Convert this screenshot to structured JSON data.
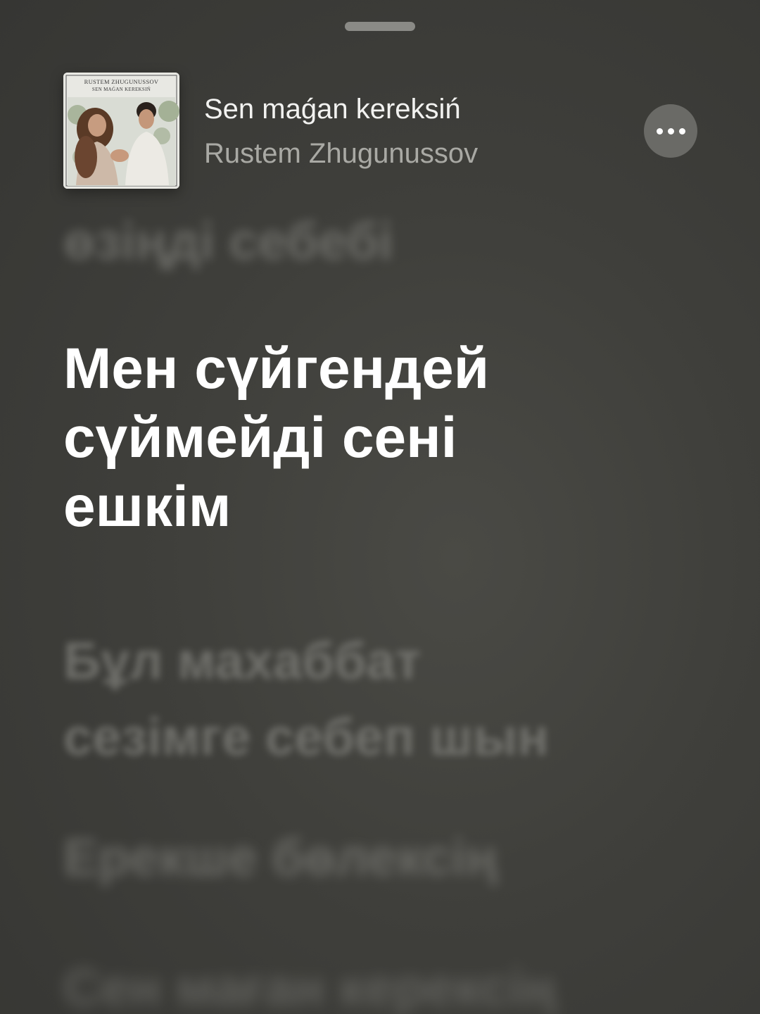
{
  "now_playing": {
    "title": "Sen maǵan kereksiń",
    "artist": "Rustem Zhugunussov",
    "artwork": {
      "artist_caption": "RUSTEM ZHUGUNUSSOV",
      "title_caption": "SEN MAǴAN KEREKSIŃ"
    },
    "more_icon": "ellipsis-icon"
  },
  "lyrics": {
    "previous": "өзіңді себебі",
    "current": [
      "Мен сүйгендей",
      "сүймейді сені",
      "ешкім"
    ],
    "next": [
      "Бұл махаббат",
      "сезімге себеп шын"
    ],
    "next2": "Ерекше бөлексің",
    "next3": "Сен маған керексің"
  }
}
